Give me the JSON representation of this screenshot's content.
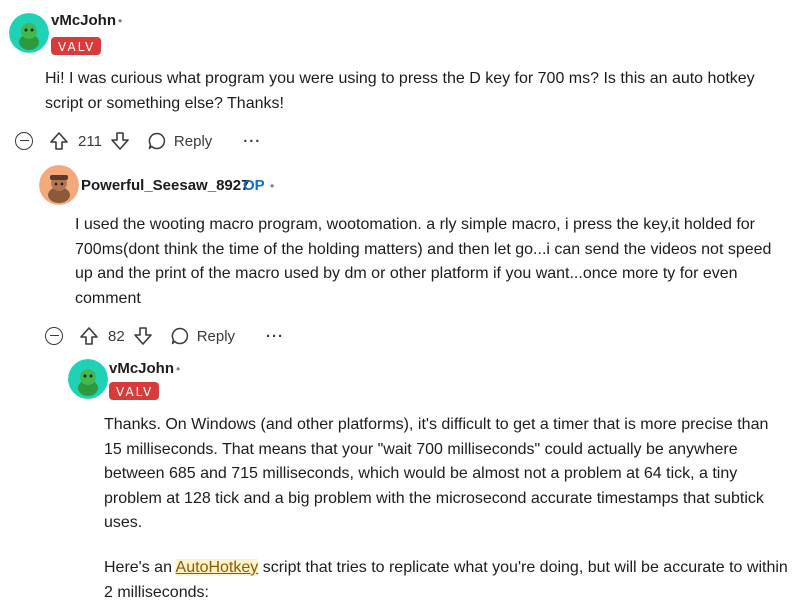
{
  "comments": [
    {
      "username": "vMcJohn",
      "flair": "VALV",
      "text": "Hi! I was curious what program you were using to press the D key for 700 ms? Is this an auto hotkey script or something else? Thanks!",
      "votes": "211",
      "reply_label": "Reply",
      "avatar_color": "#1fd1b5"
    },
    {
      "username": "Powerful_Seesaw_8927",
      "op_badge": "OP",
      "text": "I used the wooting macro program, wootomation. a rly simple macro, i press the key,it holded for 700ms(dont think the time of the holding matters) and then let go...i can send the videos not speed up and the print of the macro used by dm or other platform if you want...once more ty for even comment",
      "votes": "82",
      "reply_label": "Reply",
      "avatar_color": "#f4a97a"
    },
    {
      "username": "vMcJohn",
      "flair": "VALV",
      "paragraph1": "Thanks. On Windows (and other platforms), it's difficult to get a timer that is more precise than 15 milliseconds. That means that your \"wait 700 milliseconds\" could actually be anywhere between 685 and 715 milliseconds, which would be almost not a problem at 64 tick, a tiny problem at 128 tick and a big problem with the microsecond accurate timestamps that subtick uses.",
      "paragraph2_before": "Here's an ",
      "paragraph2_link": "AutoHotkey",
      "paragraph2_after": " script that tries to replicate what you're doing, but will be accurate to within 2 milliseconds:",
      "avatar_color": "#1fd1b5"
    }
  ],
  "more_icon": "ellipsis-icon",
  "colors": {
    "flair_bg": "#d93a3a",
    "op_blue": "#0e70c0",
    "link": "#8a5a00"
  }
}
